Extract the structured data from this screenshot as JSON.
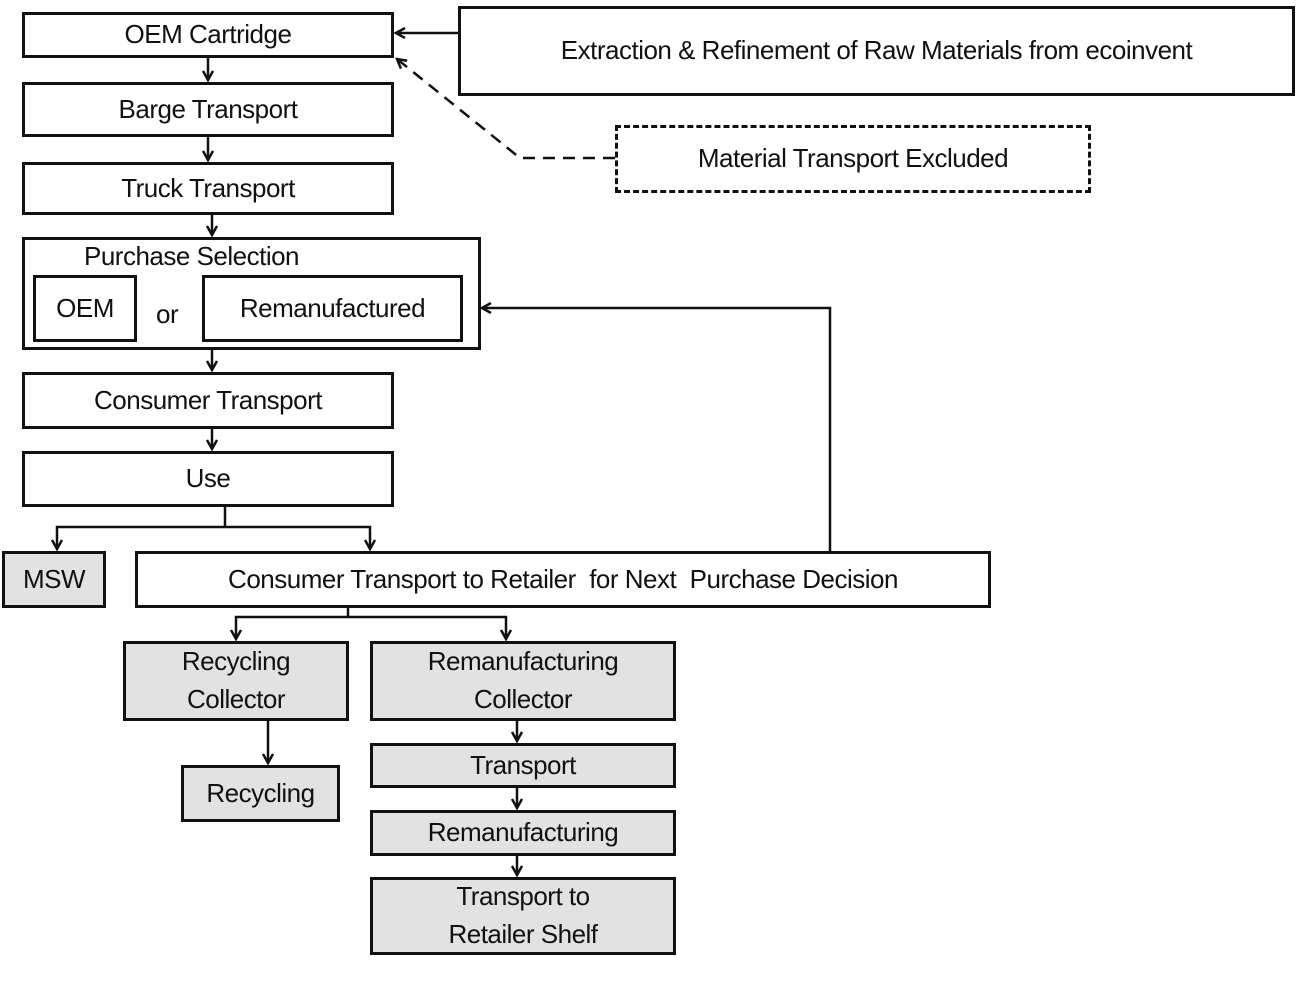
{
  "nodes": {
    "oem_cartridge": "OEM Cartridge",
    "extraction": "Extraction & Refinement of Raw Materials from ecoinvent",
    "material_transport_excluded": "Material Transport Excluded",
    "barge_transport": "Barge Transport",
    "truck_transport": "Truck Transport",
    "purchase_selection": "Purchase Selection",
    "oem": "OEM",
    "or": "or",
    "remanufactured": "Remanufactured",
    "consumer_transport": "Consumer Transport",
    "use": "Use",
    "msw": "MSW",
    "consumer_transport_retailer": "Consumer Transport to Retailer  for Next  Purchase Decision",
    "recycling_collector_1": "Recycling",
    "recycling_collector_2": "Collector",
    "reman_collector_1": "Remanufacturing",
    "reman_collector_2": "Collector",
    "recycling": "Recycling",
    "transport": "Transport",
    "remanufacturing": "Remanufacturing",
    "transport_shelf_1": "Transport to",
    "transport_shelf_2": "Retailer Shelf"
  },
  "colors": {
    "gray_fill": "#e2e2e2",
    "line": "#111111"
  }
}
